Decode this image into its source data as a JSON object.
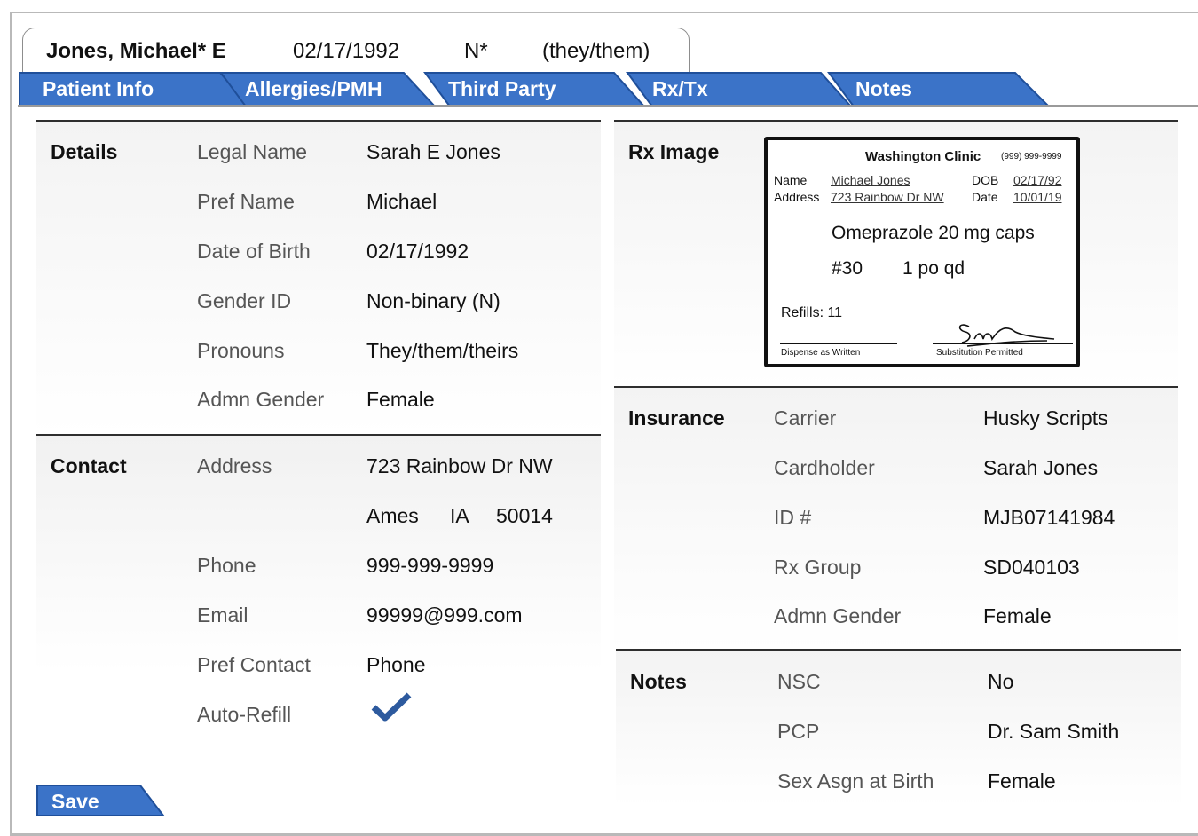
{
  "header": {
    "name": "Jones, Michael* E",
    "dob": "02/17/1992",
    "gender": "N*",
    "pronouns": "(they/them)"
  },
  "tabs": [
    {
      "label": "Patient Info",
      "active": true
    },
    {
      "label": "Allergies/PMH"
    },
    {
      "label": "Third Party"
    },
    {
      "label": "Rx/Tx"
    },
    {
      "label": "Notes"
    }
  ],
  "details": {
    "title": "Details",
    "rows": [
      {
        "label": "Legal Name",
        "value": "Sarah E Jones"
      },
      {
        "label": "Pref Name",
        "value": "Michael"
      },
      {
        "label": "Date of Birth",
        "value": "02/17/1992"
      },
      {
        "label": "Gender ID",
        "value": "Non-binary (N)"
      },
      {
        "label": "Pronouns",
        "value": "They/them/theirs"
      },
      {
        "label": "Admn Gender",
        "value": "Female"
      }
    ]
  },
  "contact": {
    "title": "Contact",
    "address_label": "Address",
    "address_line1": "723 Rainbow Dr NW",
    "city": "Ames",
    "state": "IA",
    "zip": "50014",
    "phone_label": "Phone",
    "phone": "999-999-9999",
    "email_label": "Email",
    "email": "99999@999.com",
    "pref_contact_label": "Pref Contact",
    "pref_contact": "Phone",
    "auto_refill_label": "Auto-Refill",
    "auto_refill": true,
    "check_icon": "checkmark-icon"
  },
  "rx_image": {
    "title": "Rx Image",
    "clinic": "Washington Clinic",
    "clinic_phone": "(999) 999-9999",
    "name_label": "Name",
    "name": "Michael Jones",
    "dob_label": "DOB",
    "dob": "02/17/92",
    "address_label": "Address",
    "address": "723 Rainbow Dr NW",
    "date_label": "Date",
    "date": "10/01/19",
    "drug": "Omeprazole 20 mg caps",
    "qty": "#30",
    "sig": "1 po qd",
    "refills": "Refills: 11",
    "dispense_label": "Dispense as Written",
    "substitution_label": "Substitution Permitted"
  },
  "insurance": {
    "title": "Insurance",
    "rows": [
      {
        "label": "Carrier",
        "value": "Husky Scripts"
      },
      {
        "label": "Cardholder",
        "value": "Sarah Jones"
      },
      {
        "label": "ID #",
        "value": "MJB07141984"
      },
      {
        "label": "Rx Group",
        "value": "SD040103"
      },
      {
        "label": "Admn Gender",
        "value": "Female"
      }
    ]
  },
  "notes": {
    "title": "Notes",
    "rows": [
      {
        "label": "NSC",
        "value": "No"
      },
      {
        "label": "PCP",
        "value": "Dr. Sam Smith"
      },
      {
        "label": "Sex Asgn at Birth",
        "value": "Female"
      }
    ]
  },
  "save_label": "Save",
  "colors": {
    "tab_blue": "#3b73c8",
    "tab_border": "#1f4f9a",
    "check_blue": "#2d5a9e"
  }
}
